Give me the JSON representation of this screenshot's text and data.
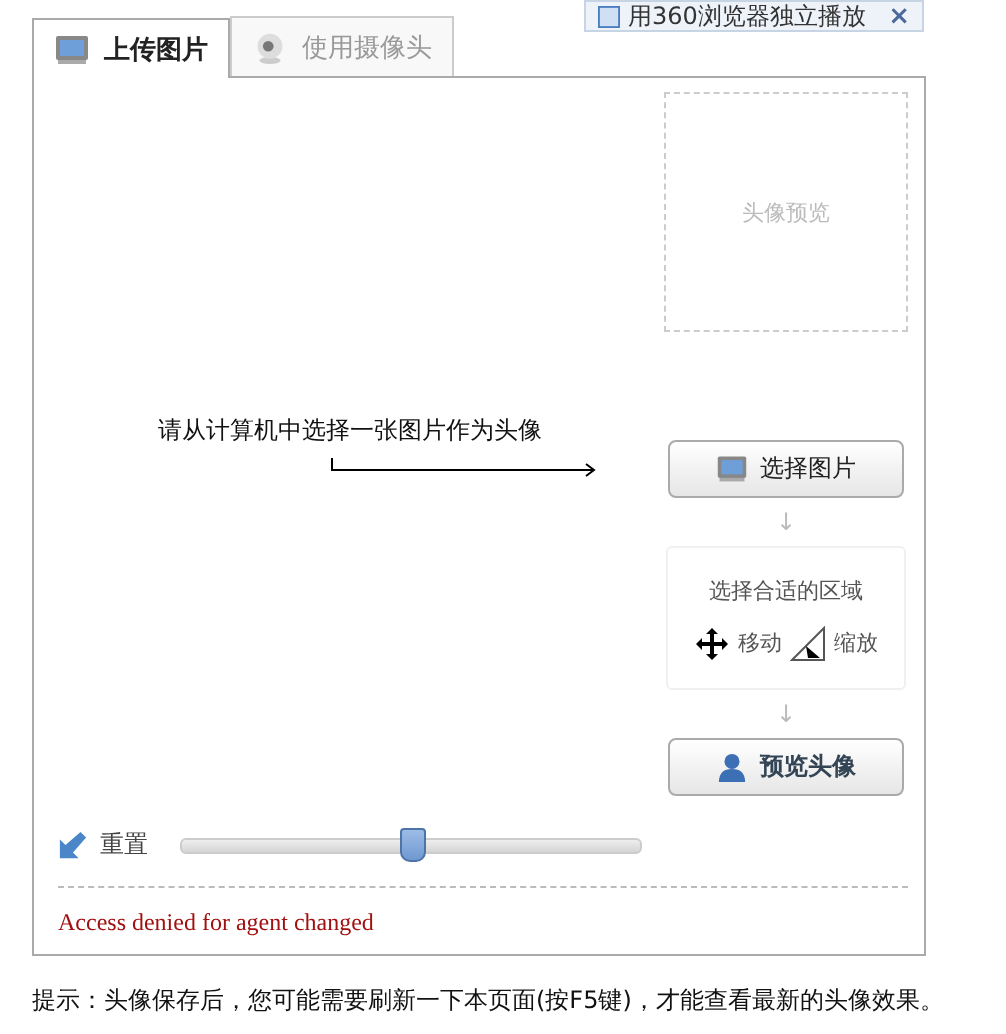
{
  "popup": {
    "label": "用360浏览器独立播放",
    "close": "×"
  },
  "tabs": [
    {
      "label": "上传图片",
      "selected": true
    },
    {
      "label": "使用摄像头",
      "selected": false
    }
  ],
  "preview": {
    "label": "头像预览"
  },
  "instruction": "请从计算机中选择一张图片作为头像",
  "choose_button": "选择图片",
  "step_arrows": [
    "↓",
    "↓"
  ],
  "area": {
    "title": "选择合适的区域",
    "move": "移动",
    "scale": "缩放"
  },
  "preview_button": "预览头像",
  "reset": {
    "label": "重置"
  },
  "slider": {
    "level": 0.5
  },
  "error": "Access denied for agent changed",
  "tip": "提示：头像保存后，您可能需要刷新一下本页面(按F5键)，才能查看最新的头像效果。"
}
